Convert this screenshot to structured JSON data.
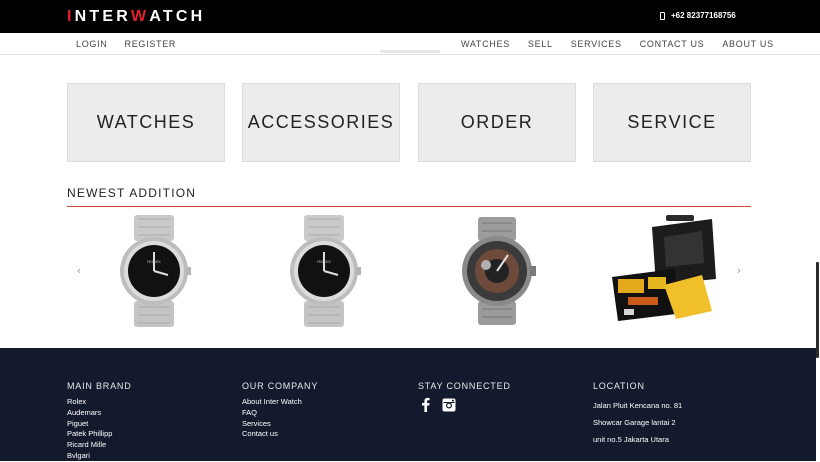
{
  "brand": {
    "part1": "I",
    "part2": "NTER ",
    "part3": "W",
    "part4": "ATCH"
  },
  "header": {
    "phone": "+62 82377168756",
    "phone_icon": "mobile-phone-icon"
  },
  "nav": {
    "left": [
      "LOGIN",
      "REGISTER"
    ],
    "right": [
      "WATCHES",
      "SELL",
      "SERVICES",
      "CONTACT US",
      "ABOUT US"
    ]
  },
  "categories": [
    "WATCHES",
    "ACCESSORIES",
    "ORDER",
    "SERVICE"
  ],
  "newest": {
    "title": "NEWEST ADDITION",
    "prev_icon": "chevron-left-icon",
    "next_icon": "chevron-right-icon",
    "products": [
      {
        "kind": "rolex-explorer-watch"
      },
      {
        "kind": "rolex-explorer-watch"
      },
      {
        "kind": "skeleton-dial-watch"
      },
      {
        "kind": "watch-case-toolkit"
      }
    ]
  },
  "footer": {
    "brands": {
      "heading": "MAIN BRAND",
      "items": [
        "Rolex",
        "Audemars",
        "Piguet",
        "Patek Phillipp",
        "Ricard Mille",
        "Bvlgari"
      ]
    },
    "company": {
      "heading": "OUR COMPANY",
      "items": [
        "About Inter Watch",
        "FAQ",
        "Services",
        "Contact us"
      ]
    },
    "social": {
      "heading": "STAY CONNECTED",
      "icons": [
        "facebook-icon",
        "instagram-icon"
      ]
    },
    "location": {
      "heading": "LOCATION",
      "lines": [
        "Jalan Pluit Kencana no. 81",
        "Showcar Garage lantai 2",
        "unit no.5 Jakarta Utara"
      ]
    }
  },
  "colors": {
    "accent": "#e2212a",
    "footer_bg": "#141a2e",
    "rule": "#d14a3a",
    "tile_bg": "#ececec"
  }
}
